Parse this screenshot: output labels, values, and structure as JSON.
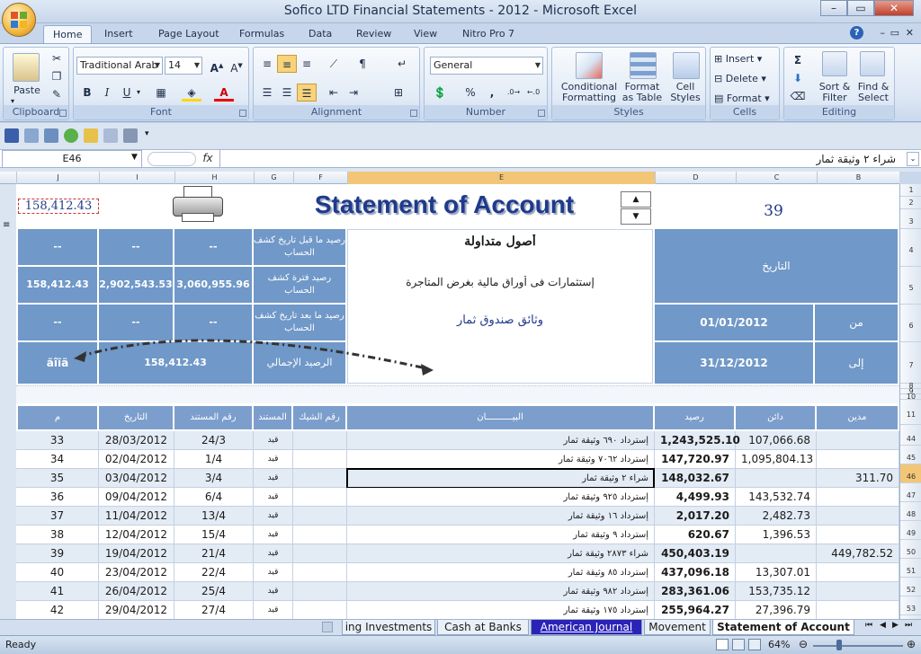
{
  "window": {
    "title": "Sofico LTD Financial Statements - 2012 - Microsoft Excel",
    "controls": {
      "minimize": "–",
      "restore": "▭",
      "close": "✕"
    }
  },
  "ribbon_tabs": [
    "Home",
    "Insert",
    "Page Layout",
    "Formulas",
    "Data",
    "Review",
    "View",
    "Nitro Pro 7"
  ],
  "ribbon": {
    "clipboard": {
      "label": "Clipboard",
      "paste": "Paste"
    },
    "font": {
      "label": "Font",
      "name": "Traditional Arab",
      "size": "14",
      "bold": "B",
      "italic": "I",
      "underline": "U"
    },
    "alignment": {
      "label": "Alignment"
    },
    "number": {
      "label": "Number",
      "format": "General",
      "percent": "%",
      "comma": ","
    },
    "styles": {
      "label": "Styles",
      "conditional": "Conditional Formatting",
      "format_table": "Format as Table",
      "cell_styles": "Cell Styles"
    },
    "cells": {
      "label": "Cells",
      "insert": "Insert",
      "delete": "Delete",
      "format": "Format"
    },
    "editing": {
      "label": "Editing",
      "sort": "Sort & Filter",
      "find": "Find & Select"
    }
  },
  "formula_bar": {
    "name_box": "E46",
    "fx": "fx",
    "content": "شراء ٢ وثيقة ثمار"
  },
  "columns": [
    "J",
    "I",
    "H",
    "G",
    "F",
    "E",
    "D",
    "C",
    "B"
  ],
  "statement": {
    "title": "Statement of Account",
    "total_top": "158,412.43",
    "number": "39",
    "row1": {
      "label": "رصيد ما قبل تاريخ كشف الحساب",
      "j": "--",
      "i": "--",
      "h": "--"
    },
    "row2": {
      "label": "رصيد فترة كشف الحساب",
      "j": "158,412.43",
      "i": "2,902,543.53",
      "h": "3,060,955.96"
    },
    "row3": {
      "label": "رصيد ما بعد تاريخ كشف الحساب",
      "j": "--",
      "i": "--",
      "h": "--"
    },
    "row4": {
      "label": "الرصيد الإجمالي",
      "value": "158,412.43",
      "j": "ãîĩä"
    },
    "assets": "أصول متداولة",
    "investments": "إستثمارات فى أوراق مالية بغرض المتاجرة",
    "fund": "وثائق صندوق ثمار",
    "date_label": "التاريخ",
    "from_label": "من",
    "to_label": "إلى",
    "from_date": "01/01/2012",
    "to_date": "31/12/2012"
  },
  "table_headers": {
    "m": "م",
    "date": "التاريخ",
    "doc_no": "رقم المستند",
    "doc": "المستند",
    "cheque": "رقم الشيك",
    "desc": "البيــــــــــان",
    "balance": "رصيد",
    "credit": "دائن",
    "debit": "مدين"
  },
  "rows": [
    {
      "row": "44",
      "m": "33",
      "date": "28/03/2012",
      "doc_no": "24/3",
      "doc": "قيد يومية",
      "desc": "إسترداد ٦٩٠ وثيقة ثمار",
      "balance": "1,243,525.10",
      "credit": "107,066.68",
      "debit": ""
    },
    {
      "row": "45",
      "m": "34",
      "date": "02/04/2012",
      "doc_no": "1/4",
      "doc": "قيد يومية",
      "desc": "إسترداد ٧٠٦٢ وثيقة ثمار",
      "balance": "147,720.97",
      "credit": "1,095,804.13",
      "debit": ""
    },
    {
      "row": "46",
      "m": "35",
      "date": "03/04/2012",
      "doc_no": "3/4",
      "doc": "قيد يومية",
      "desc": "شراء ٢ وثيقة ثمار",
      "balance": "148,032.67",
      "credit": "",
      "debit": "311.70"
    },
    {
      "row": "47",
      "m": "36",
      "date": "09/04/2012",
      "doc_no": "6/4",
      "doc": "قيد يومية",
      "desc": "إسترداد ٩٢٥ وثيقة ثمار",
      "balance": "4,499.93",
      "credit": "143,532.74",
      "debit": ""
    },
    {
      "row": "48",
      "m": "37",
      "date": "11/04/2012",
      "doc_no": "13/4",
      "doc": "قيد يومية",
      "desc": "إسترداد ١٦ وثيقة ثمار",
      "balance": "2,017.20",
      "credit": "2,482.73",
      "debit": ""
    },
    {
      "row": "49",
      "m": "38",
      "date": "12/04/2012",
      "doc_no": "15/4",
      "doc": "قيد يومية",
      "desc": "إسترداد ٩ وثيقة ثمار",
      "balance": "620.67",
      "credit": "1,396.53",
      "debit": ""
    },
    {
      "row": "50",
      "m": "39",
      "date": "19/04/2012",
      "doc_no": "21/4",
      "doc": "قيد يومية",
      "desc": "شراء ٢٨٧٣ وثيقة ثمار",
      "balance": "450,403.19",
      "credit": "",
      "debit": "449,782.52"
    },
    {
      "row": "51",
      "m": "40",
      "date": "23/04/2012",
      "doc_no": "22/4",
      "doc": "قيد يومية",
      "desc": "إسترداد ٨٥ وثيقة ثمار",
      "balance": "437,096.18",
      "credit": "13,307.01",
      "debit": ""
    },
    {
      "row": "52",
      "m": "41",
      "date": "26/04/2012",
      "doc_no": "25/4",
      "doc": "قيد يومية",
      "desc": "إسترداد ٩٨٢ وثيقة ثمار",
      "balance": "283,361.06",
      "credit": "153,735.12",
      "debit": ""
    },
    {
      "row": "53",
      "m": "42",
      "date": "29/04/2012",
      "doc_no": "27/4",
      "doc": "قيد يومية",
      "desc": "إسترداد ١٧٥ وثيقة ثمار",
      "balance": "255,964.27",
      "credit": "27,396.79",
      "debit": ""
    }
  ],
  "row_headers_top": [
    "1",
    "2",
    "3",
    "4",
    "5",
    "6",
    "7",
    "8",
    "9",
    "10",
    "11"
  ],
  "sheet_tabs": [
    "ing Investments",
    "Cash at Banks",
    "American Journal",
    "Movement",
    "Statement of Account"
  ],
  "status": {
    "ready": "Ready",
    "zoom": "64%"
  },
  "colors": {
    "header_blue": "#7098c8",
    "title_blue": "#1f3a8a",
    "tab_purple": "#2b22b8"
  }
}
